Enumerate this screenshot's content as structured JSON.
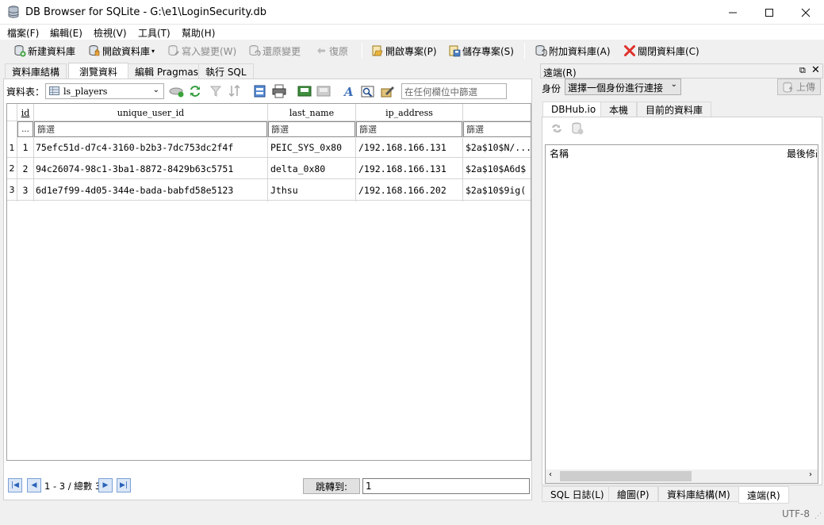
{
  "window": {
    "title": "DB Browser for SQLite - G:\\e1\\LoginSecurity.db"
  },
  "menu": [
    "檔案(F)",
    "編輯(E)",
    "檢視(V)",
    "工具(T)",
    "幫助(H)"
  ],
  "toolbar": {
    "new_db": "新建資料庫",
    "open_db": "開啟資料庫",
    "write_changes": "寫入變更(W)",
    "revert_changes": "還原變更",
    "undo": "復原",
    "open_project": "開啟專案(P)",
    "save_project": "儲存專案(S)",
    "attach_db": "附加資料庫(A)",
    "close_db": "關閉資料庫(C)"
  },
  "tabs": [
    "資料庫結構",
    "瀏覽資料",
    "編輯 Pragmas",
    "執行 SQL"
  ],
  "browse": {
    "table_label": "資料表：",
    "table_selected": "ls_players",
    "filter_any_placeholder": "在任何欄位中篩選",
    "filter_placeholder": "篩選",
    "filter_menu": "...",
    "columns": [
      "id",
      "unique_user_id",
      "last_name",
      "ip_address",
      ""
    ],
    "rows": [
      {
        "rownum": "1",
        "id": "1",
        "unique_user_id": "75efc51d-d7c4-3160-b2b3-7dc753dc2f4f",
        "last_name": "PEIC_SYS_0x80",
        "ip_address": "/192.168.166.131",
        "password": "$2a$10$N/..."
      },
      {
        "rownum": "2",
        "id": "2",
        "unique_user_id": "94c26074-98c1-3ba1-8872-8429b63c5751",
        "last_name": "delta_0x80",
        "ip_address": "/192.168.166.131",
        "password": "$2a$10$A6d$"
      },
      {
        "rownum": "3",
        "id": "3",
        "unique_user_id": "6d1e7f99-4d05-344e-bada-babfd58e5123",
        "last_name": "Jthsu",
        "ip_address": "/192.168.166.202",
        "password": "$2a$10$9ig("
      }
    ],
    "page_info": "1 - 3 / 總數 3",
    "goto_label": "跳轉到:",
    "goto_value": "1"
  },
  "remote": {
    "title": "遠端(R)",
    "identity_label": "身份",
    "identity_select": "選擇一個身份進行連接",
    "upload": "上傳",
    "subtabs": [
      "DBHub.io",
      "本機",
      "目前的資料庫"
    ],
    "col_name": "名稱",
    "col_modified": "最後修改"
  },
  "bottom_tabs": [
    "SQL 日誌(L)",
    "繪圖(P)",
    "資料庫結構(M)",
    "遠端(R)"
  ],
  "status": {
    "encoding": "UTF-8"
  }
}
